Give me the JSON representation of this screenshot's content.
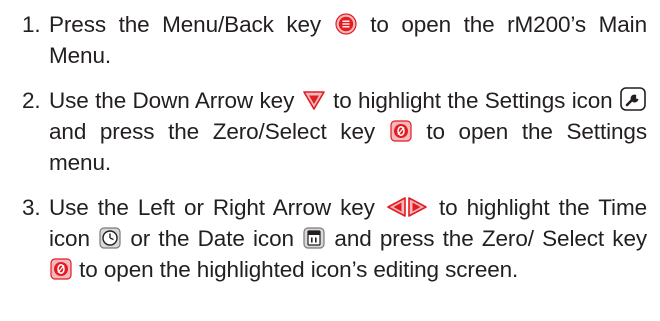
{
  "steps": [
    {
      "number": "1.",
      "parts": [
        "Press the Menu/Back key",
        "to open the rM200’s Main Menu."
      ]
    },
    {
      "number": "2.",
      "parts": [
        "Use the Down Arrow key",
        "to highlight the Settings icon",
        "and press the Zero/Select key",
        "to open the Settings menu."
      ]
    },
    {
      "number": "3.",
      "parts": [
        "Use the Left or Right Arrow key",
        "to highlight the Time icon",
        "or the Date icon",
        "and press the Zero/ Select key",
        "to open the highlighted icon’s editing screen."
      ]
    }
  ],
  "icons": {
    "menu_back_key": "menu-back-key-icon",
    "down_arrow_key": "down-arrow-key-icon",
    "settings": "wrench-settings-icon",
    "zero_select_key": "zero-select-key-icon",
    "left_right_arrow_keys": "left-right-arrow-keys-icon",
    "time": "clock-time-icon",
    "date": "calendar-date-icon"
  },
  "colors": {
    "text": "#231f20",
    "key_red": "#e31b23",
    "icon_gray": "#7a7a7a"
  }
}
